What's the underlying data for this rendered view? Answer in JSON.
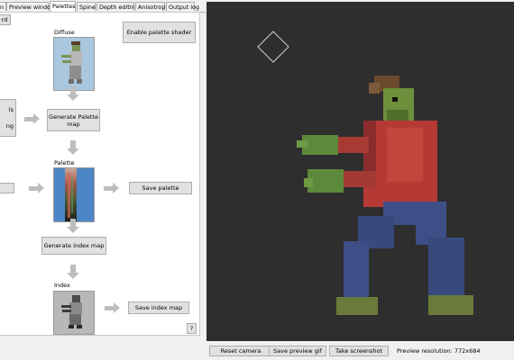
{
  "tabs": [
    {
      "label": "n",
      "active": false
    },
    {
      "label": "Preview window",
      "active": false
    },
    {
      "label": "Palettes",
      "active": true
    },
    {
      "label": "Spine",
      "active": false
    },
    {
      "label": "Depth editing",
      "active": false
    },
    {
      "label": "Anisotropy",
      "active": false
    },
    {
      "label": "Output log",
      "active": false
    }
  ],
  "palettes_panel": {
    "partial_top_button": "rd",
    "diffuse_label": "Diffuse",
    "enable_shader_button": "Enable palette shader",
    "partial_left_text_1": "ls",
    "partial_left_text_2": "ng",
    "generate_palette_map_button": "Generate Palette map",
    "palette_label": "Palette",
    "save_palette_button": "Save palette",
    "generate_index_map_button": "Generate index map",
    "index_label": "Index",
    "save_index_map_button": "Save index map",
    "help_button": "?"
  },
  "bottom_bar": {
    "reset_camera": "Reset camera",
    "save_preview_gif": "Save preview gif",
    "take_screenshot": "Take screenshot",
    "preview_resolution": "Preview resolution: 772x684"
  },
  "colors": {
    "viewport_bg": "#2e2e2e",
    "zombie_skin": "#5d8a3a",
    "zombie_shirt": "#b53a35",
    "zombie_jeans": "#3d4f86",
    "zombie_hair": "#6b4a2c"
  },
  "icons": {
    "arrow_down": "arrow-down-icon",
    "arrow_right": "arrow-right-icon",
    "gizmo": "diamond-gizmo-icon"
  }
}
